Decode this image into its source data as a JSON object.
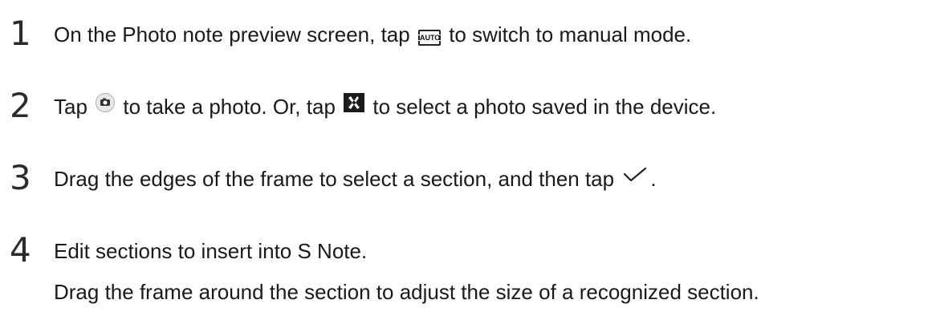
{
  "steps": [
    {
      "number": "1",
      "before": "On the Photo note preview screen, tap",
      "icon": "auto-mode-icon",
      "icon_text": "AUTO",
      "after": "to switch to manual mode."
    },
    {
      "number": "2",
      "before": "Tap",
      "icon": "camera-icon",
      "middle": "to take a photo. Or, tap",
      "icon2": "gallery-icon",
      "after": "to select a photo saved in the device."
    },
    {
      "number": "3",
      "before": "Drag the edges of the frame to select a section, and then tap",
      "icon": "checkmark-icon",
      "after": "."
    },
    {
      "number": "4",
      "before": "Edit sections to insert into S Note.",
      "sub": "Drag the frame around the section to adjust the size of a recognized section."
    }
  ]
}
